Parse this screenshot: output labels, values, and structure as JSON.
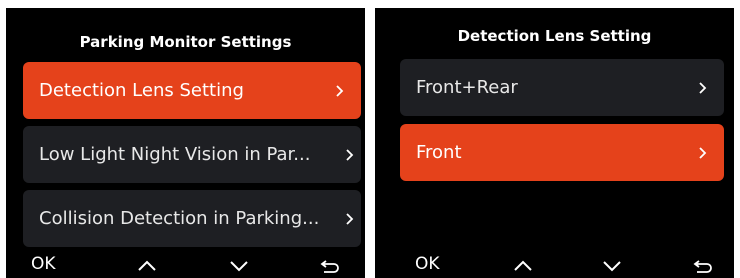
{
  "left_screen": {
    "title": "Parking Monitor Settings",
    "items": [
      {
        "label": "Detection Lens Setting",
        "selected": true
      },
      {
        "label": "Low Light Night  Vision in Par...",
        "selected": false
      },
      {
        "label": "Collision Detection in Parking...",
        "selected": false
      }
    ],
    "nav": {
      "ok_label": "OK",
      "icons": [
        "chevron-up-icon",
        "chevron-down-icon",
        "back-arrow-icon"
      ]
    }
  },
  "right_screen": {
    "title": "Detection Lens Setting",
    "items": [
      {
        "label": "Front+Rear",
        "selected": false
      },
      {
        "label": "Front",
        "selected": true
      }
    ],
    "nav": {
      "ok_label": "OK",
      "icons": [
        "chevron-up-icon",
        "chevron-down-icon",
        "back-arrow-icon"
      ]
    }
  },
  "colors": {
    "accent": "#e5421b",
    "item_bg": "#1e1f23",
    "screen_bg": "#000000",
    "text": "#ffffff"
  }
}
